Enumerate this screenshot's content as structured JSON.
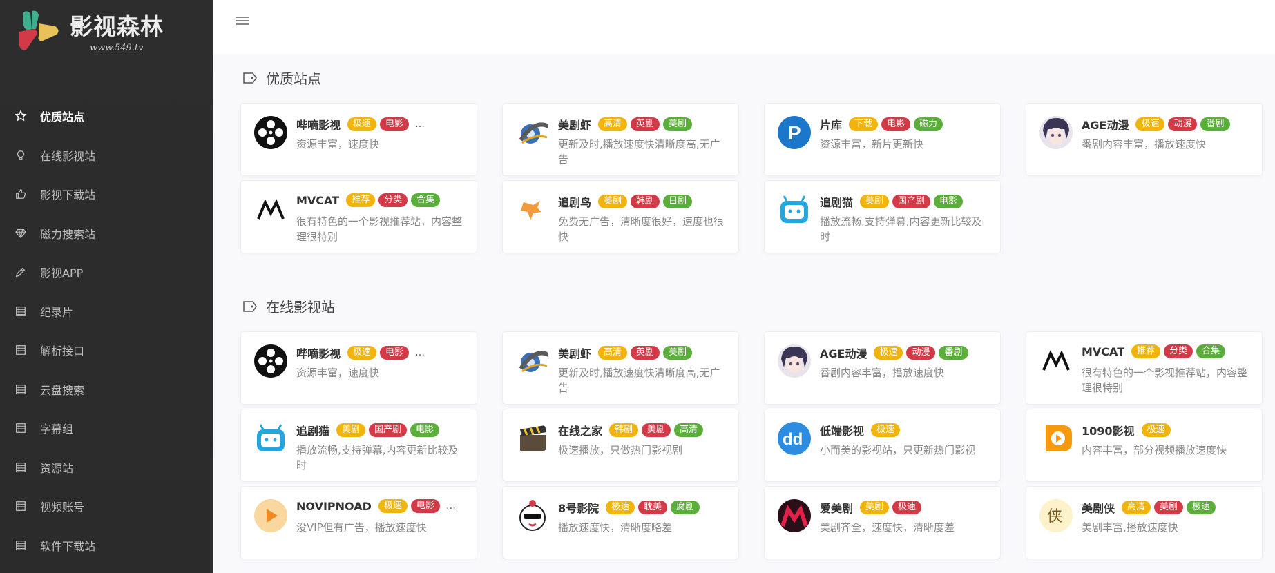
{
  "logo": {
    "title": "影视森林",
    "subtitle": "www.549.tv"
  },
  "sidebar": {
    "items": [
      {
        "label": "优质站点",
        "icon": "star-icon",
        "active": true
      },
      {
        "label": "在线影视站",
        "icon": "bulb-icon",
        "active": false
      },
      {
        "label": "影视下载站",
        "icon": "thumb-up-icon",
        "active": false
      },
      {
        "label": "磁力搜索站",
        "icon": "diamond-icon",
        "active": false
      },
      {
        "label": "影视APP",
        "icon": "pencil-icon",
        "active": false
      },
      {
        "label": "纪录片",
        "icon": "grid-icon",
        "active": false
      },
      {
        "label": "解析接口",
        "icon": "grid-icon",
        "active": false
      },
      {
        "label": "云盘搜索",
        "icon": "grid-icon",
        "active": false
      },
      {
        "label": "字幕组",
        "icon": "grid-icon",
        "active": false
      },
      {
        "label": "资源站",
        "icon": "grid-icon",
        "active": false
      },
      {
        "label": "视频账号",
        "icon": "grid-icon",
        "active": false
      },
      {
        "label": "软件下载站",
        "icon": "grid-icon",
        "active": false
      }
    ]
  },
  "sections": [
    {
      "title": "优质站点",
      "cards": [
        {
          "name": "哔嘀影视",
          "tags": [
            [
              "极速",
              "y"
            ],
            [
              "电影",
              "r"
            ]
          ],
          "more": "…",
          "desc": "资源丰富，速度快",
          "icon": "film-reel-icon"
        },
        {
          "name": "美剧虾",
          "tags": [
            [
              "高清",
              "y"
            ],
            [
              "英剧",
              "r"
            ],
            [
              "美剧",
              "g"
            ]
          ],
          "more": "",
          "desc": "更新及时,播放速度快清晰度高,无广告",
          "icon": "film-roll-icon"
        },
        {
          "name": "片库",
          "tags": [
            [
              "下载",
              "y"
            ],
            [
              "电影",
              "r"
            ],
            [
              "磁力",
              "g"
            ]
          ],
          "more": "",
          "desc": "资源丰富，新片更新快",
          "icon": "p-logo-icon"
        },
        {
          "name": "AGE动漫",
          "tags": [
            [
              "极速",
              "y"
            ],
            [
              "动漫",
              "r"
            ],
            [
              "番剧",
              "g"
            ]
          ],
          "more": "",
          "desc": "番剧内容丰富，播放速度快",
          "icon": "anime-avatar-icon"
        },
        {
          "name": "MVCAT",
          "tags": [
            [
              "推荐",
              "y"
            ],
            [
              "分类",
              "r"
            ],
            [
              "合集",
              "g"
            ]
          ],
          "more": "",
          "desc": "很有特色的一个影视推荐站，内容整理很特别",
          "icon": "m-logo-icon"
        },
        {
          "name": "追剧鸟",
          "tags": [
            [
              "美剧",
              "y"
            ],
            [
              "韩剧",
              "r"
            ],
            [
              "日剧",
              "g"
            ]
          ],
          "more": "",
          "desc": "免费无广告，清晰度很好，速度也很快",
          "icon": "bird-icon"
        },
        {
          "name": "追剧猫",
          "tags": [
            [
              "美剧",
              "y"
            ],
            [
              "国产剧",
              "r"
            ],
            [
              "电影",
              "g"
            ]
          ],
          "more": "",
          "desc": "播放流畅,支持弹幕,内容更新比较及时",
          "icon": "tv-bot-icon"
        }
      ]
    },
    {
      "title": "在线影视站",
      "cards": [
        {
          "name": "哔嘀影视",
          "tags": [
            [
              "极速",
              "y"
            ],
            [
              "电影",
              "r"
            ]
          ],
          "more": "…",
          "desc": "资源丰富，速度快",
          "icon": "film-reel-icon"
        },
        {
          "name": "美剧虾",
          "tags": [
            [
              "高清",
              "y"
            ],
            [
              "英剧",
              "r"
            ],
            [
              "美剧",
              "g"
            ]
          ],
          "more": "",
          "desc": "更新及时,播放速度快清晰度高,无广告",
          "icon": "film-roll-icon"
        },
        {
          "name": "AGE动漫",
          "tags": [
            [
              "极速",
              "y"
            ],
            [
              "动漫",
              "r"
            ],
            [
              "番剧",
              "g"
            ]
          ],
          "more": "",
          "desc": "番剧内容丰富，播放速度快",
          "icon": "anime-avatar-icon"
        },
        {
          "name": "MVCAT",
          "tags": [
            [
              "推荐",
              "y"
            ],
            [
              "分类",
              "r"
            ],
            [
              "合集",
              "g"
            ]
          ],
          "more": "",
          "desc": "很有特色的一个影视推荐站，内容整理很特别",
          "icon": "m-logo-icon"
        },
        {
          "name": "追剧猫",
          "tags": [
            [
              "美剧",
              "y"
            ],
            [
              "国产剧",
              "r"
            ],
            [
              "电影",
              "g"
            ]
          ],
          "more": "",
          "desc": "播放流畅,支持弹幕,内容更新比较及时",
          "icon": "tv-bot-icon"
        },
        {
          "name": "在线之家",
          "tags": [
            [
              "韩剧",
              "y"
            ],
            [
              "美剧",
              "r"
            ],
            [
              "高清",
              "g"
            ]
          ],
          "more": "",
          "desc": "极速播放，只做热门影视剧",
          "icon": "clapper-icon"
        },
        {
          "name": "低端影视",
          "tags": [
            [
              "极速",
              "y"
            ]
          ],
          "more": "",
          "desc": "小而美的影视站，只更新热门影视",
          "icon": "dd-logo-icon"
        },
        {
          "name": "1090影视",
          "tags": [
            [
              "极速",
              "y"
            ]
          ],
          "more": "",
          "desc": "内容丰富，部分视频播放速度快",
          "icon": "play-orange-icon"
        },
        {
          "name": "NOVIPNOAD",
          "tags": [
            [
              "极速",
              "y"
            ],
            [
              "电影",
              "r"
            ]
          ],
          "more": "…",
          "desc": "没VIP但有广告，播放速度快",
          "icon": "play-peach-icon"
        },
        {
          "name": "8号影院",
          "tags": [
            [
              "极速",
              "y"
            ],
            [
              "耽美",
              "r"
            ],
            [
              "腐剧",
              "g"
            ]
          ],
          "more": "",
          "desc": "播放速度快，清晰度略差",
          "icon": "cartoon-icon"
        },
        {
          "name": "爱美剧",
          "tags": [
            [
              "美剧",
              "y"
            ],
            [
              "极速",
              "r"
            ]
          ],
          "more": "",
          "desc": "美剧齐全，速度快，清晰度差",
          "icon": "m-red-icon"
        },
        {
          "name": "美剧侠",
          "tags": [
            [
              "高清",
              "y"
            ],
            [
              "美剧",
              "r"
            ],
            [
              "极速",
              "g"
            ]
          ],
          "more": "",
          "desc": "美剧丰富,播放速度快",
          "icon": "xia-icon"
        }
      ]
    }
  ]
}
